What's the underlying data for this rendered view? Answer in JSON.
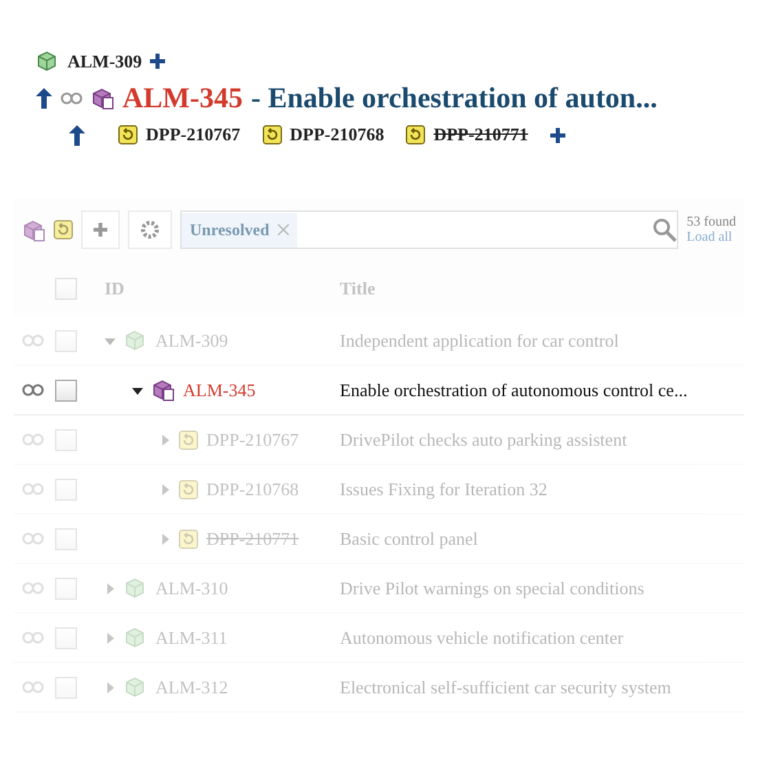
{
  "header": {
    "parent": {
      "id": "ALM-309",
      "kind": "feature"
    },
    "issue": {
      "id": "ALM-345",
      "kind": "epic",
      "title": "- Enable orchestration of auton..."
    },
    "children": [
      {
        "id": "DPP-210767",
        "kind": "story",
        "resolved": false
      },
      {
        "id": "DPP-210768",
        "kind": "story",
        "resolved": false
      },
      {
        "id": "DPP-210771",
        "kind": "story",
        "resolved": true
      }
    ]
  },
  "toolbar": {
    "filter": "Unresolved",
    "found": "53 found",
    "load_all": "Load all"
  },
  "table": {
    "columns": [
      "ID",
      "Title"
    ],
    "select_all": {
      "checked": false
    },
    "rows": [
      {
        "id": "ALM-309",
        "kind": "feature",
        "title": "Independent application for car control",
        "expanded": true,
        "selected": false,
        "resolved": false,
        "children": [
          {
            "id": "ALM-345",
            "kind": "epic",
            "title": "Enable orchestration of autonomous control ce...",
            "expanded": true,
            "selected": true,
            "resolved": false,
            "children": [
              {
                "id": "DPP-210767",
                "kind": "story",
                "title": "DrivePilot checks auto parking assistent",
                "expanded": false,
                "selected": false,
                "resolved": false
              },
              {
                "id": "DPP-210768",
                "kind": "story",
                "title": "Issues Fixing for Iteration 32",
                "expanded": false,
                "selected": false,
                "resolved": false
              },
              {
                "id": "DPP-210771",
                "kind": "story",
                "title": "Basic control panel",
                "expanded": false,
                "selected": false,
                "resolved": true
              }
            ]
          }
        ]
      },
      {
        "id": "ALM-310",
        "kind": "feature",
        "title": "Drive Pilot warnings on special conditions",
        "expanded": false,
        "selected": false,
        "resolved": false
      },
      {
        "id": "ALM-311",
        "kind": "feature",
        "title": "Autonomous vehicle notification center",
        "expanded": false,
        "selected": false,
        "resolved": false
      },
      {
        "id": "ALM-312",
        "kind": "feature",
        "title": "Electronical self-sufficient car security system",
        "expanded": false,
        "selected": false,
        "resolved": false
      }
    ]
  }
}
